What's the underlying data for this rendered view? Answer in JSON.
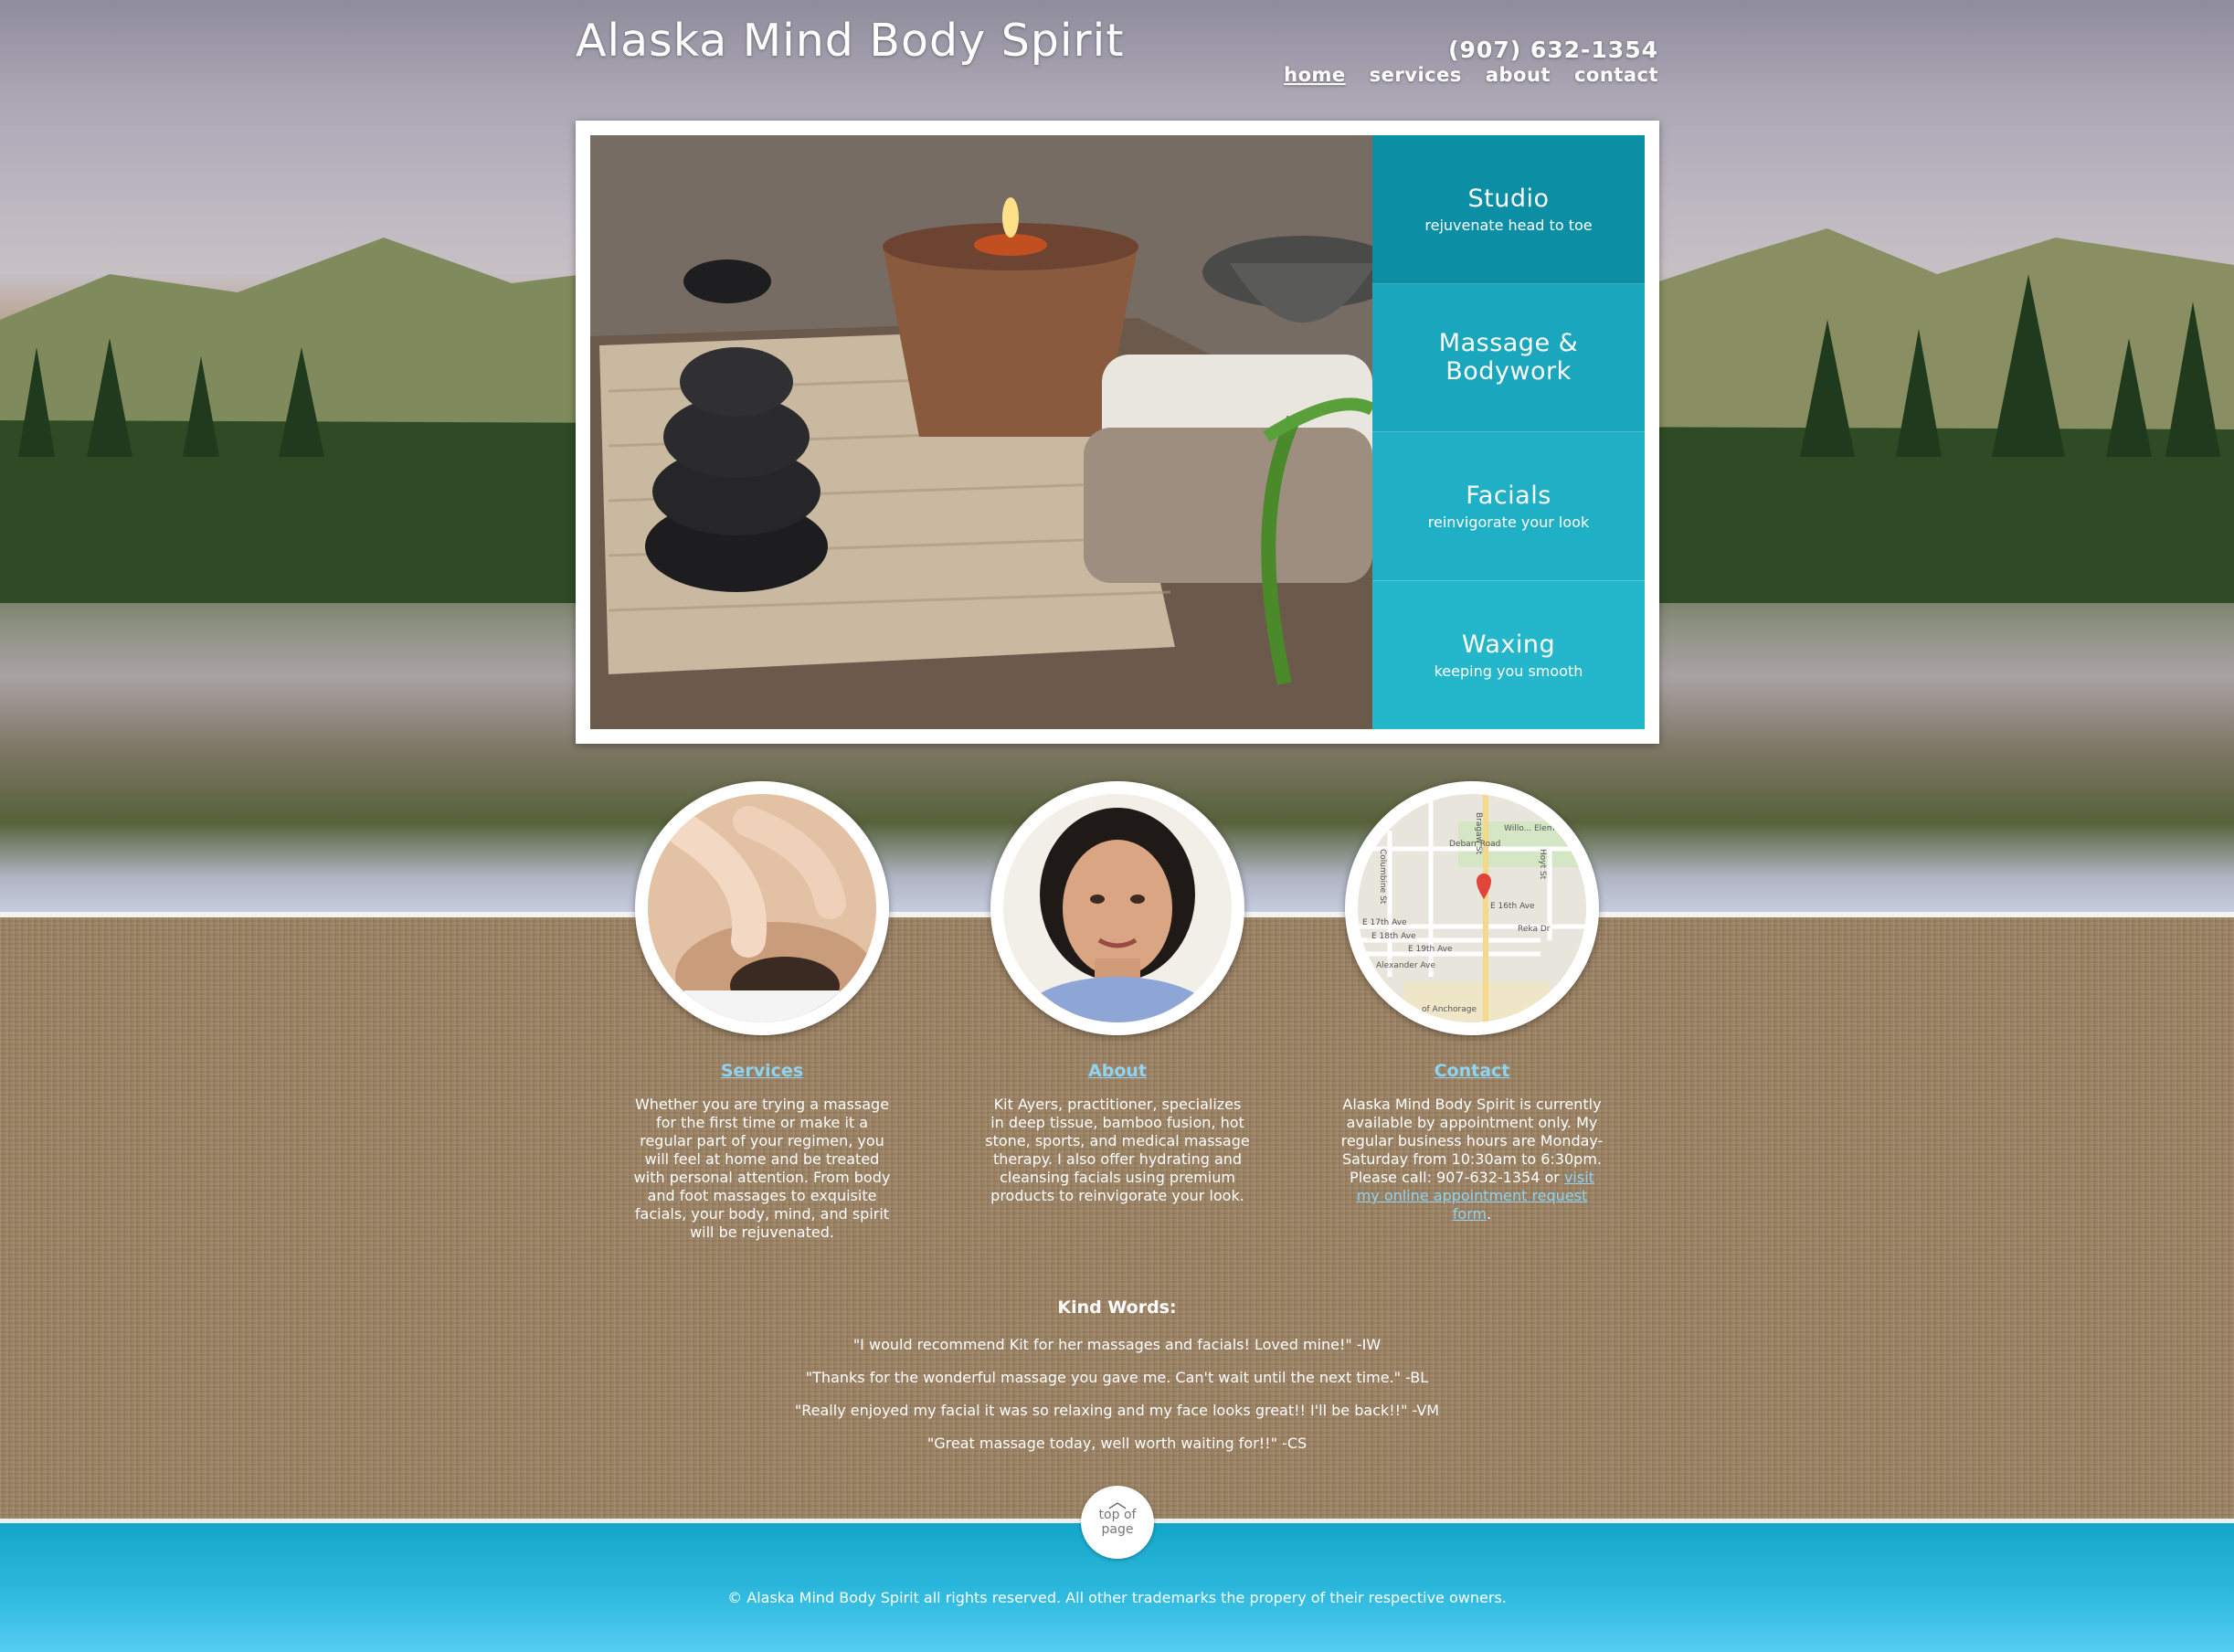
{
  "header": {
    "site_title": "Alaska Mind Body Spirit",
    "phone": "(907) 632-1354",
    "nav": [
      {
        "label": "home",
        "active": true
      },
      {
        "label": "services",
        "active": false
      },
      {
        "label": "about",
        "active": false
      },
      {
        "label": "contact",
        "active": false
      }
    ]
  },
  "slider": {
    "tabs": [
      {
        "title": "Studio",
        "subtitle": "rejuvenate head to toe"
      },
      {
        "title": "Massage & Bodywork",
        "subtitle": ""
      },
      {
        "title": "Facials",
        "subtitle": "reinvigorate your look"
      },
      {
        "title": "Waxing",
        "subtitle": "keeping you smooth"
      }
    ]
  },
  "features": [
    {
      "link": "Services",
      "text": "Whether you are trying a massage for the first time or make it a regular part of your regimen, you will feel at home and be treated with personal attention. From body and foot massages to exquisite facials, your body, mind, and spirit will be rejuvenated."
    },
    {
      "link": "About",
      "text": "Kit Ayers, practitioner, specializes in deep tissue, bamboo fusion, hot stone, sports, and medical massage therapy. I also offer hydrating and cleansing facials using premium products to reinvigorate your look."
    },
    {
      "link": "Contact",
      "text": "Alaska Mind Body Spirit is currently available by appointment only. My regular business hours are Monday-Saturday from 10:30am to 6:30pm. Please call: 907-632-1354 or ",
      "text_link": "visit my online appointment request form",
      "text_end": "."
    }
  ],
  "map_labels": {
    "school": "Willo... Elementary Scho...",
    "debarr": "Debarr Road",
    "e17": "E 17th Ave",
    "e18": "E 18th Ave",
    "e19": "E 19th Ave",
    "e16": "E 16th Ave",
    "alexander": "Alexander Ave",
    "anchorage": "of Anchorage",
    "bragaw": "Bragaw St",
    "reka": "Reka Dr",
    "columbine": "Columbine St",
    "hoyt": "Hoyt St"
  },
  "testimonials": {
    "heading": "Kind Words:",
    "quotes": [
      "\"I would recommend Kit for her massages and facials! Loved mine!\" -IW",
      "\"Thanks for the wonderful massage you gave me. Can't wait until the next time.\" -BL",
      "\"Really enjoyed my facial it was so relaxing and my face looks great!! I'll be back!!\" -VM",
      "\"Great massage today, well worth waiting for!!\" -CS"
    ]
  },
  "footer": {
    "top_of_page": "top of page",
    "copyright": "© Alaska Mind Body Spirit all rights reserved. All other trademarks the propery of their respective owners."
  },
  "colors": {
    "tab_dark": "#0c8ea4",
    "tab_light": "#24b6cb",
    "link": "#8fd3f0",
    "footer": "#2bb7dc"
  }
}
